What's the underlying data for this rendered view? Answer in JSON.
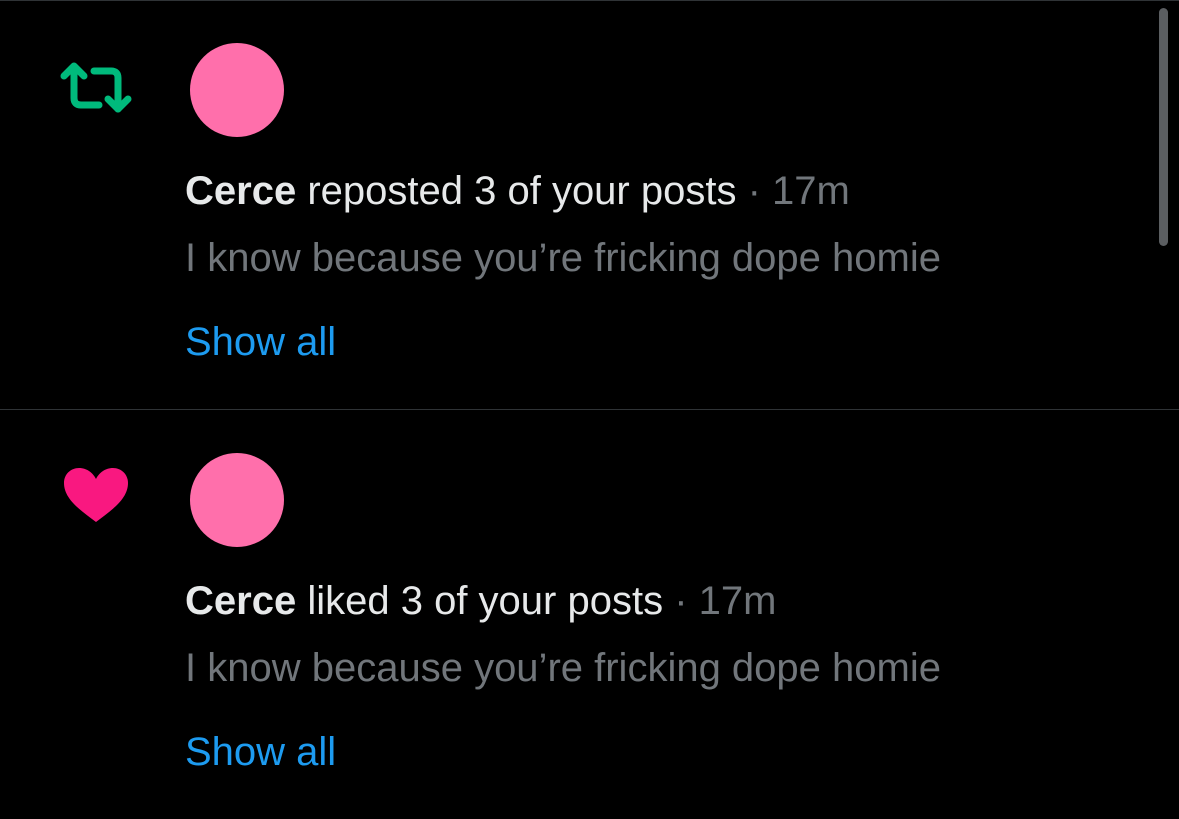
{
  "colors": {
    "background": "#000000",
    "repost_icon": "#00ba7c",
    "like_icon": "#f91880",
    "avatar": "#ff6fab",
    "primary_text": "#e7e9ea",
    "secondary_text": "#71767b",
    "link": "#1d9bf0"
  },
  "notifications": [
    {
      "icon": "repost-icon",
      "user_name": "Cerce",
      "action_text": "reposted 3 of your posts",
      "separator": "·",
      "time": "17m",
      "preview": "I know because you’re fricking dope homie",
      "show_all_label": "Show all"
    },
    {
      "icon": "heart-icon",
      "user_name": "Cerce",
      "action_text": "liked 3 of your posts",
      "separator": "·",
      "time": "17m",
      "preview": "I know because you’re fricking dope homie",
      "show_all_label": "Show all"
    }
  ]
}
